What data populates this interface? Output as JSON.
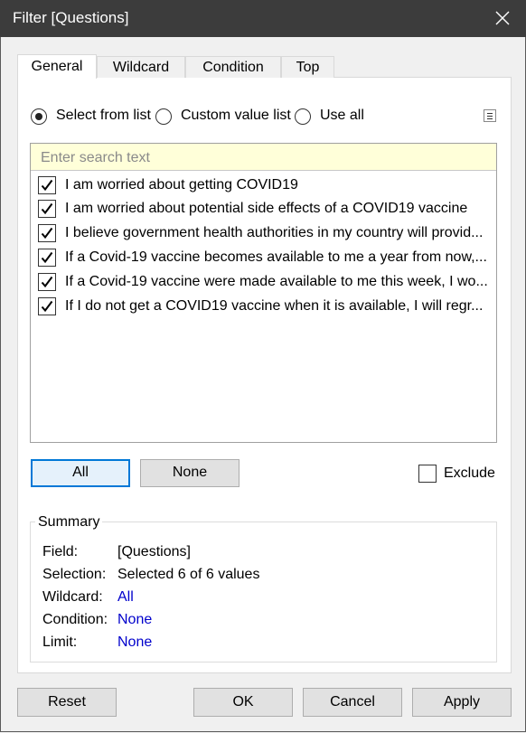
{
  "window": {
    "title": "Filter [Questions]"
  },
  "tabs": [
    {
      "label": "General",
      "active": true
    },
    {
      "label": "Wildcard",
      "active": false
    },
    {
      "label": "Condition",
      "active": false
    },
    {
      "label": "Top",
      "active": false
    }
  ],
  "mode": {
    "options": [
      {
        "label": "Select from list",
        "selected": true
      },
      {
        "label": "Custom value list",
        "selected": false
      },
      {
        "label": "Use all",
        "selected": false
      }
    ]
  },
  "list": {
    "search_placeholder": "Enter search text",
    "items": [
      {
        "label": "I am worried about getting COVID19",
        "checked": true
      },
      {
        "label": "I am worried about potential side effects of a COVID19 vaccine",
        "checked": true
      },
      {
        "label": "I believe government health authorities in my country will provid...",
        "checked": true
      },
      {
        "label": "If a Covid-19 vaccine becomes available to me a year from now,...",
        "checked": true
      },
      {
        "label": "If a Covid-19 vaccine were made available to me this week, I wo...",
        "checked": true
      },
      {
        "label": "If I do not get a COVID19 vaccine when it is available, I will regr...",
        "checked": true
      }
    ]
  },
  "selection_buttons": {
    "all": "All",
    "none": "None"
  },
  "exclude": {
    "label": "Exclude",
    "checked": false
  },
  "summary": {
    "legend": "Summary",
    "rows": [
      {
        "key": "Field:",
        "value": "[Questions]",
        "link": false
      },
      {
        "key": "Selection:",
        "value": "Selected 6 of 6 values",
        "link": false
      },
      {
        "key": "Wildcard:",
        "value": "All",
        "link": true
      },
      {
        "key": "Condition:",
        "value": "None",
        "link": true
      },
      {
        "key": "Limit:",
        "value": "None",
        "link": true
      }
    ]
  },
  "footer": {
    "reset": "Reset",
    "ok": "OK",
    "cancel": "Cancel",
    "apply": "Apply"
  },
  "colors": {
    "titlebar": "#3c3c3c",
    "search_bg": "#ffffd9",
    "link": "#0000cc",
    "focus": "#0078d7"
  }
}
